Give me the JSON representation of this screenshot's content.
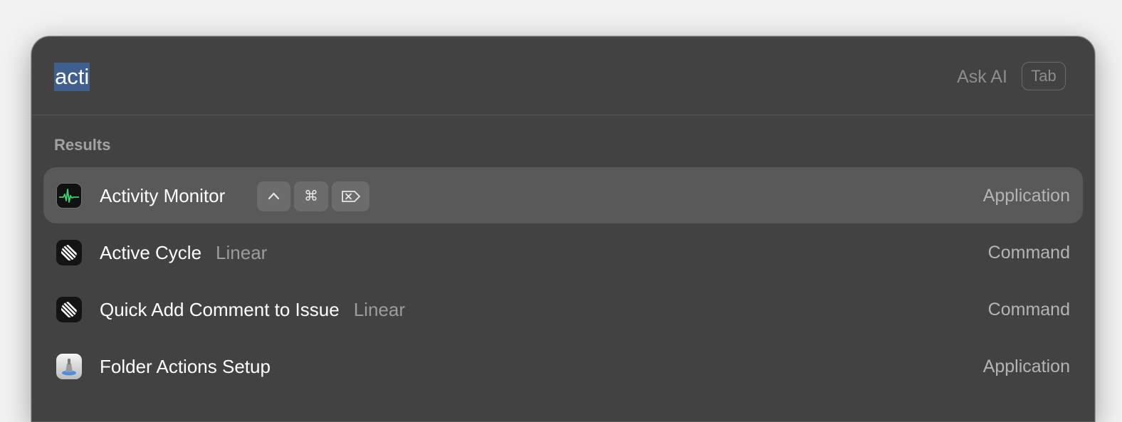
{
  "search": {
    "value": "acti",
    "ask_ai_label": "Ask AI",
    "tab_key": "Tab"
  },
  "results": {
    "section_title": "Results",
    "items": [
      {
        "title": "Activity Monitor",
        "subtitle": "",
        "type": "Application",
        "icon": "activity-monitor-icon",
        "selected": true,
        "shortcut_keys": [
          "^",
          "⌘",
          "⌦"
        ]
      },
      {
        "title": "Active Cycle",
        "subtitle": "Linear",
        "type": "Command",
        "icon": "linear-icon",
        "selected": false
      },
      {
        "title": "Quick Add Comment to Issue",
        "subtitle": "Linear",
        "type": "Command",
        "icon": "linear-icon",
        "selected": false
      },
      {
        "title": "Folder Actions Setup",
        "subtitle": "",
        "type": "Application",
        "icon": "folder-actions-setup-icon",
        "selected": false
      }
    ]
  },
  "colors": {
    "window_bg": "#424242",
    "selected_row_bg": "#595959",
    "selection_highlight": "#3f5f8f"
  }
}
